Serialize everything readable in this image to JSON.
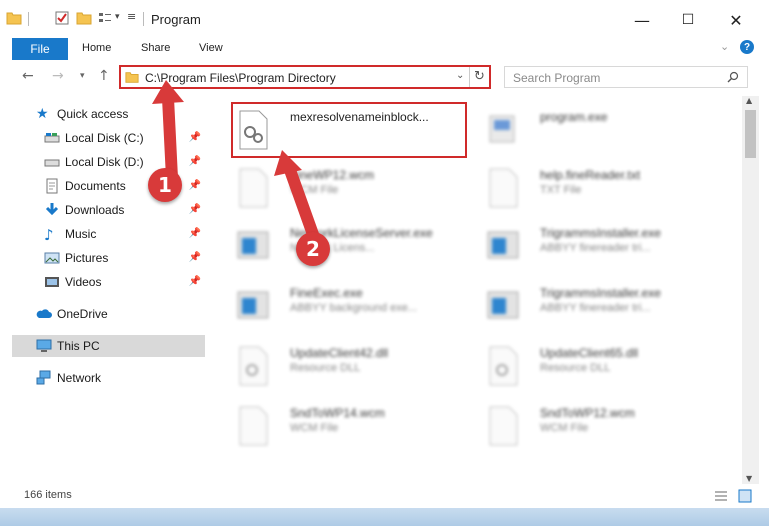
{
  "window": {
    "title": "Program",
    "minimize": "—",
    "maximize": "☐",
    "close": "✕"
  },
  "ribbon": {
    "tabs": [
      "File",
      "Home",
      "Share",
      "View"
    ]
  },
  "address": {
    "path": "C:\\Program Files\\Program Directory"
  },
  "search": {
    "placeholder": "Search Program"
  },
  "sidebar": {
    "items": [
      {
        "label": "Quick access",
        "icon": "star-icon",
        "pinned": false
      },
      {
        "label": "Local Disk (C:)",
        "icon": "drive-icon",
        "pinned": true
      },
      {
        "label": "Local Disk (D:)",
        "icon": "drive-icon",
        "pinned": true
      },
      {
        "label": "Documents",
        "icon": "documents-icon",
        "pinned": true
      },
      {
        "label": "Downloads",
        "icon": "download-icon",
        "pinned": true
      },
      {
        "label": "Music",
        "icon": "music-icon",
        "pinned": true
      },
      {
        "label": "Pictures",
        "icon": "pictures-icon",
        "pinned": true
      },
      {
        "label": "Videos",
        "icon": "videos-icon",
        "pinned": true
      },
      {
        "label": "OneDrive",
        "icon": "cloud-icon",
        "pinned": false
      },
      {
        "label": "This PC",
        "icon": "computer-icon",
        "pinned": false,
        "selected": true
      },
      {
        "label": "Network",
        "icon": "network-icon",
        "pinned": false
      }
    ]
  },
  "files": [
    {
      "name": "mexresolvenameinblock...",
      "type": "",
      "icon": "dll-gear-icon"
    },
    {
      "name": "program.exe",
      "type": "",
      "icon": "exe-icon"
    },
    {
      "name": "FineWP12.wcm",
      "type": "WCM File",
      "icon": "file-icon"
    },
    {
      "name": "help.fineReader.txt",
      "type": "TXT File",
      "icon": "file-icon"
    },
    {
      "name": "NetworkLicenseServer.exe",
      "type": "Network Licens...",
      "icon": "app-window-icon"
    },
    {
      "name": "TrigrammsInstaller.exe",
      "type": "ABBYY finereader tri...",
      "icon": "app-window-icon"
    },
    {
      "name": "FineExec.exe",
      "type": "ABBYY background exe...",
      "icon": "app-window-icon"
    },
    {
      "name": "TrigrammsInstaller.exe",
      "type": "ABBYY finereader tri...",
      "icon": "app-window-icon"
    },
    {
      "name": "UpdateClient42.dll",
      "type": "Resource DLL",
      "icon": "dll-gear-icon"
    },
    {
      "name": "UpdateClient65.dll",
      "type": "Resource DLL",
      "icon": "dll-gear-icon"
    },
    {
      "name": "SndToWP14.wcm",
      "type": "WCM File",
      "icon": "file-icon"
    },
    {
      "name": "SndToWP12.wcm",
      "type": "WCM File",
      "icon": "file-icon"
    }
  ],
  "status": {
    "item_count": "166 items"
  },
  "annotations": {
    "badge1": "1",
    "badge2": "2"
  },
  "colors": {
    "accent": "#1979ca",
    "highlight": "#d02a2a",
    "badge": "#d83a3a"
  }
}
